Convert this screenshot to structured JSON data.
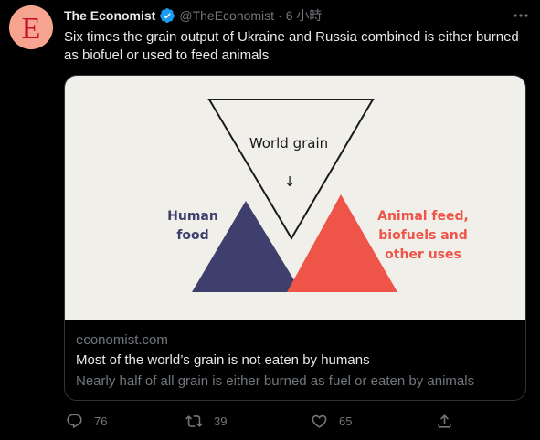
{
  "tweet": {
    "author_name": "The Economist",
    "handle": "@TheEconomist",
    "separator": "·",
    "time": "6 小時",
    "avatar_letter": "E",
    "text": "Six times the grain output of Ukraine and Russia combined is either burned as biofuel or used to feed animals"
  },
  "card": {
    "image": {
      "top_label": "World grain",
      "arrow": "↓",
      "left_label_line1": "Human",
      "left_label_line2": "food",
      "right_label_line1": "Animal feed,",
      "right_label_line2": "biofuels and",
      "right_label_line3": "other uses"
    },
    "domain": "economist.com",
    "title": "Most of the world’s grain is not eaten by humans",
    "description": "Nearly half of all grain is either burned as fuel or eaten by animals"
  },
  "actions": {
    "replies": "76",
    "retweets": "39",
    "likes": "65"
  },
  "colors": {
    "background": "#000000",
    "avatar_bg": "#f6a48f",
    "logo_red": "#c8102e",
    "card_bg": "#f0efea",
    "navy": "#3e3f6d",
    "coral": "#ef5448",
    "verified": "#1d9bf0",
    "muted": "#71767b"
  }
}
